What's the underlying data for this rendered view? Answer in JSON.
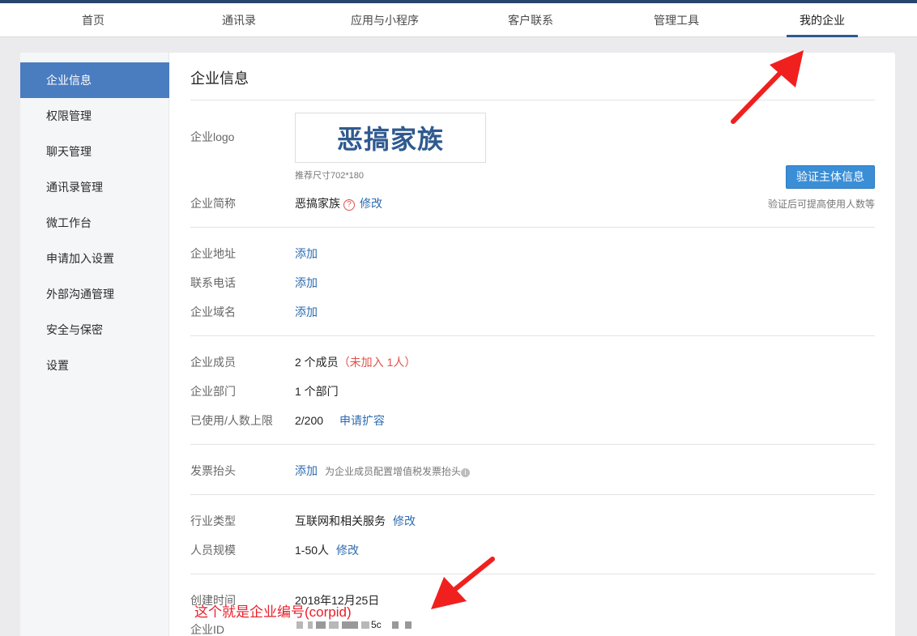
{
  "nav": {
    "items": [
      "首页",
      "通讯录",
      "应用与小程序",
      "客户联系",
      "管理工具",
      "我的企业"
    ],
    "active": "我的企业"
  },
  "sidebar": {
    "items": [
      "企业信息",
      "权限管理",
      "聊天管理",
      "通讯录管理",
      "微工作台",
      "申请加入设置",
      "外部沟通管理",
      "安全与保密",
      "设置"
    ],
    "active": "企业信息"
  },
  "main": {
    "title": "企业信息",
    "logo": {
      "label": "企业logo",
      "text": "恶搞家族",
      "hint": "推荐尺寸702*180"
    },
    "verify": {
      "button": "验证主体信息",
      "note": "验证后可提高使用人数等"
    },
    "short_name": {
      "label": "企业简称",
      "value": "恶搞家族",
      "help_icon": "?",
      "action": "修改"
    },
    "address": {
      "label": "企业地址",
      "action": "添加"
    },
    "phone": {
      "label": "联系电话",
      "action": "添加"
    },
    "domain": {
      "label": "企业域名",
      "action": "添加"
    },
    "members": {
      "label": "企业成员",
      "value": "2 个成员",
      "extra": "（未加入 1人）"
    },
    "departments": {
      "label": "企业部门",
      "value": "1 个部门"
    },
    "quota": {
      "label": "已使用/人数上限",
      "value": "2/200",
      "action": "申请扩容"
    },
    "invoice": {
      "label": "发票抬头",
      "action": "添加",
      "note": "为企业成员配置增值税发票抬头",
      "info_icon": "i"
    },
    "industry": {
      "label": "行业类型",
      "value": "互联网和相关服务",
      "action": "修改"
    },
    "scale": {
      "label": "人员规模",
      "value": "1-50人",
      "action": "修改"
    },
    "created": {
      "label": "创建时间",
      "value": "2018年12月25日"
    },
    "corp_id": {
      "label": "企业ID",
      "visible_fragment": "5c"
    }
  },
  "annotation": {
    "text": "这个就是企业编号(corpid)",
    "color": "#e8202a"
  },
  "colors": {
    "accent_bar": "#27446b",
    "sidebar_active": "#4a7cc0",
    "link": "#2d6bb0",
    "button": "#3a8ed6",
    "warning": "#e2504a",
    "arrow": "#f0201e"
  }
}
